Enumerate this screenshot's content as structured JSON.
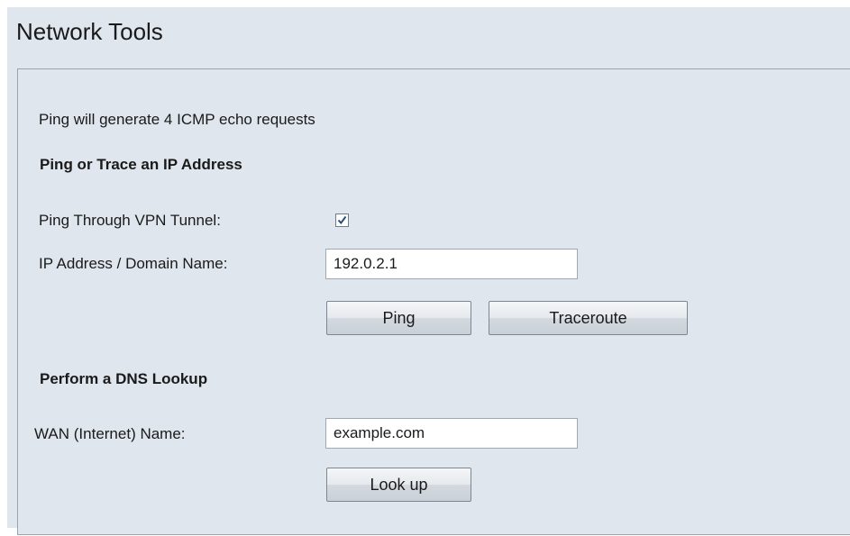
{
  "header": {
    "title": "Network Tools"
  },
  "info_text": "Ping will generate 4 ICMP echo requests",
  "ping_section": {
    "heading": "Ping or Trace an IP Address",
    "vpn_label": "Ping Through VPN Tunnel:",
    "vpn_checked": true,
    "ip_label": "IP Address / Domain Name:",
    "ip_value": "192.0.2.1",
    "ping_button": "Ping",
    "traceroute_button": "Traceroute"
  },
  "dns_section": {
    "heading": "Perform a DNS Lookup",
    "wan_label": "WAN (Internet) Name:",
    "wan_value": "example.com",
    "lookup_button": "Look up"
  },
  "colors": {
    "background": "#dfe6ee",
    "border": "#9aa4ae",
    "check": "#2a4a7c"
  },
  "icons": {
    "vpn_checkbox": "checkmark-icon"
  }
}
